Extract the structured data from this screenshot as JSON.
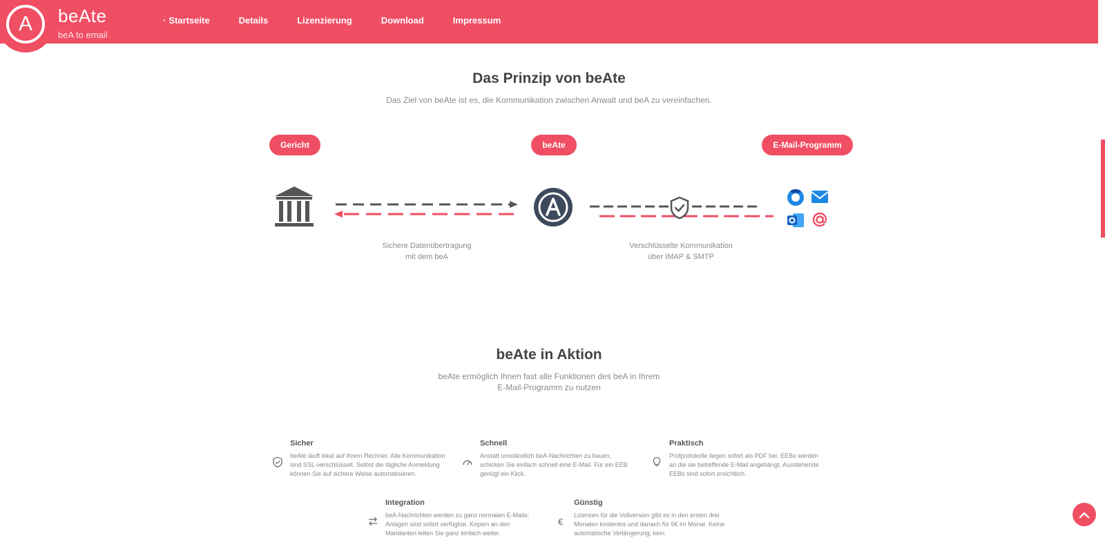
{
  "brand": {
    "name": "beAte",
    "tagline": "beA to email",
    "logo_letter": "A"
  },
  "nav": {
    "items": [
      "Startseite",
      "Details",
      "Lizenzierung",
      "Download",
      "Impressum"
    ],
    "active_index": 0
  },
  "principle": {
    "title": "Das Prinzip von beAte",
    "subtitle": "Das Ziel von beAte ist es, die Kommunikation zwischen Anwalt und beA zu vereinfachen.",
    "pills": {
      "court": "Gericht",
      "beate": "beAte",
      "mail": "E-Mail-Programm"
    },
    "caption_left": [
      "Sichere Datenübertragung",
      "mit dem beA"
    ],
    "caption_right": [
      "Verschlüsselte Kommunikation",
      "über IMAP & SMTP"
    ]
  },
  "action": {
    "title": "beAte in Aktion",
    "subtitle": [
      "beAte ermöglich Ihnen fast alle Funktionen des beA in Ihrem",
      "E-Mail-Programm zu nutzen"
    ]
  },
  "features": [
    {
      "title": "Sicher",
      "text": "beAte läuft lokal auf Ihrem Rechner. Alle Kommunikation sind SSL-verschlüsselt. Selbst die tägliche Anmeldung können Sie auf sichere Weise automatisieren.",
      "icon": "shield-check-icon"
    },
    {
      "title": "Schnell",
      "text": "Anstatt umständlich beA-Nachrichten zu bauen, schicken Sie einfach schnell eine E-Mail. Für ein EEB genügt ein Klick.",
      "icon": "speedometer-icon"
    },
    {
      "title": "Praktisch",
      "text": "Prüfprotokolle liegen sofort als PDF bei. EEBs werden an die sie betreffende E-Mail angehängt. Ausstehende EEBs sind sofort ersichtlich.",
      "icon": "lightbulb-icon"
    },
    {
      "title": "Integration",
      "text": "beA-Nachrichten werden zu ganz normalen E-Mails: Anlagen sind sofort verfügbar. Kopien an den Mandanten leiten Sie ganz einfach weiter.",
      "icon": "swap-icon"
    },
    {
      "title": "Günstig",
      "text": "Lizenzen für die Vollversion gibt es in den ersten drei Monaten kostenlos und danach für 5€ im Monat. Keine automatische Verlängerung, kein",
      "icon": "euro-icon"
    }
  ],
  "colors": {
    "accent": "#f04e63",
    "dark": "#3c4a5c",
    "blue": "#1e88e5"
  }
}
